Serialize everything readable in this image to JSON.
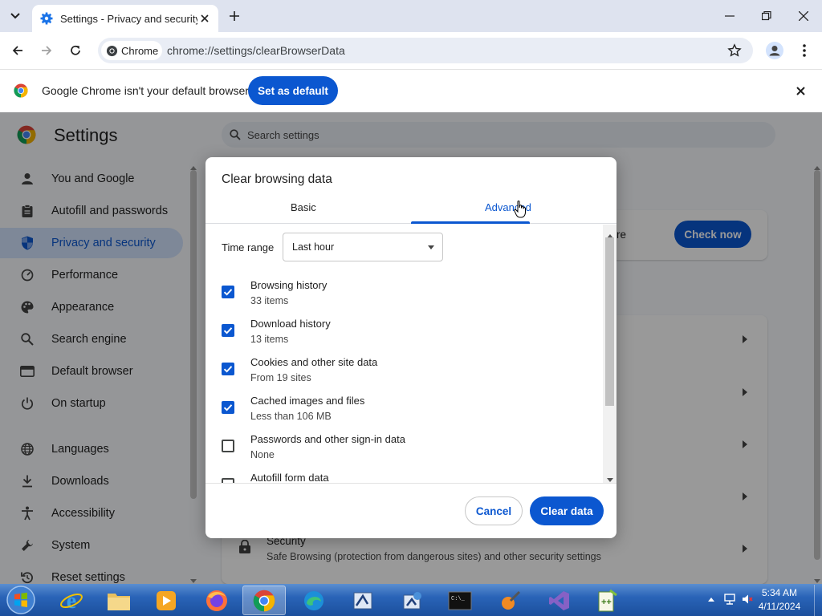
{
  "window": {
    "tab_title": "Settings - Privacy and security"
  },
  "toolbar": {
    "chip_label": "Chrome",
    "url": "chrome://settings/clearBrowserData"
  },
  "infobar": {
    "message": "Google Chrome isn't your default browser",
    "set_default_label": "Set as default"
  },
  "settings": {
    "title": "Settings",
    "search_placeholder": "Search settings",
    "nav": [
      {
        "label": "You and Google",
        "icon": "person-icon"
      },
      {
        "label": "Autofill and passwords",
        "icon": "clipboard-icon"
      },
      {
        "label": "Privacy and security",
        "icon": "shield-icon",
        "active": true
      },
      {
        "label": "Performance",
        "icon": "speedometer-icon"
      },
      {
        "label": "Appearance",
        "icon": "palette-icon"
      },
      {
        "label": "Search engine",
        "icon": "search-icon"
      },
      {
        "label": "Default browser",
        "icon": "browser-window-icon"
      },
      {
        "label": "On startup",
        "icon": "power-icon"
      },
      {
        "label": "Languages",
        "icon": "globe-icon"
      },
      {
        "label": "Downloads",
        "icon": "download-icon"
      },
      {
        "label": "Accessibility",
        "icon": "accessibility-icon"
      },
      {
        "label": "System",
        "icon": "wrench-icon"
      },
      {
        "label": "Reset settings",
        "icon": "reset-icon"
      }
    ],
    "safety_check_suffix": "re",
    "check_now_label": "Check now",
    "security_title": "Security",
    "security_desc": "Safe Browsing (protection from dangerous sites) and other security settings"
  },
  "dialog": {
    "title": "Clear browsing data",
    "tabs": {
      "basic": "Basic",
      "advanced": "Advanced"
    },
    "time_range_label": "Time range",
    "time_range_value": "Last hour",
    "options": [
      {
        "title": "Browsing history",
        "subtitle": "33 items",
        "checked": true
      },
      {
        "title": "Download history",
        "subtitle": "13 items",
        "checked": true
      },
      {
        "title": "Cookies and other site data",
        "subtitle": "From 19 sites",
        "checked": true
      },
      {
        "title": "Cached images and files",
        "subtitle": "Less than 106 MB",
        "checked": true
      },
      {
        "title": "Passwords and other sign-in data",
        "subtitle": "None",
        "checked": false
      },
      {
        "title": "Autofill form data",
        "subtitle": "",
        "checked": false
      }
    ],
    "cancel_label": "Cancel",
    "clear_label": "Clear data"
  },
  "taskbar": {
    "time": "5:34 AM",
    "date": "4/11/2024",
    "apps": [
      "start-orb",
      "internet-explorer",
      "file-explorer",
      "media-player",
      "firefox",
      "chrome",
      "edge",
      "app-1",
      "app-2",
      "command-prompt",
      "paint",
      "visual-studio",
      "notepad-plus-plus"
    ]
  }
}
